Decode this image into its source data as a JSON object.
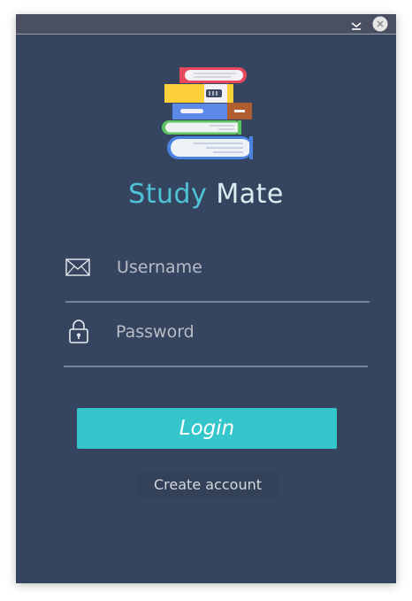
{
  "titlebar": {
    "minimize_icon": "chevron-down-icon",
    "close_icon": "close-icon"
  },
  "logo": {
    "icon": "books-stack-icon"
  },
  "app_title": {
    "part1": "Study",
    "part2": "Mate"
  },
  "username": {
    "icon": "envelope-icon",
    "placeholder": "Username",
    "value": ""
  },
  "password": {
    "icon": "lock-icon",
    "placeholder": "Password",
    "value": ""
  },
  "login_button": {
    "label": "Login"
  },
  "create_account": {
    "label": "Create account"
  },
  "colors": {
    "background": "#36455f",
    "accent": "#35c6cc",
    "title_primary": "#4fc3d6",
    "title_secondary": "#d8eff2"
  }
}
